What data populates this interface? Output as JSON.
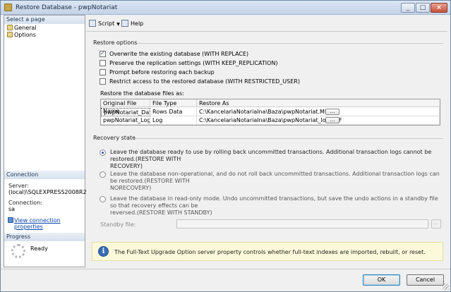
{
  "window": {
    "title": "Restore Database - pwpNotariat"
  },
  "sidebar": {
    "select_page_header": "Select a page",
    "pages": [
      {
        "label": "General",
        "icon": "page-icon"
      },
      {
        "label": "Options",
        "icon": "page-icon"
      }
    ],
    "connection": {
      "header": "Connection",
      "server_label": "Server:",
      "server_value": "(local)\\SQLEXPRESS2008R2",
      "connection_label": "Connection:",
      "connection_value": "sa",
      "view_properties_link": "View connection properties"
    },
    "progress": {
      "header": "Progress",
      "status": "Ready"
    }
  },
  "toolbar": {
    "script_label": "Script",
    "help_label": "Help"
  },
  "restore_options": {
    "title": "Restore options",
    "checkboxes": [
      {
        "label": "Overwrite the existing database (WITH REPLACE)",
        "checked": true
      },
      {
        "label": "Preserve the replication settings (WITH KEEP_REPLICATION)",
        "checked": false
      },
      {
        "label": "Prompt before restoring each backup",
        "checked": false
      },
      {
        "label": "Restrict access to the restored database (WITH RESTRICTED_USER)",
        "checked": false
      }
    ],
    "files_label": "Restore the database files as:",
    "grid": {
      "headers": [
        "Original File Name",
        "File Type",
        "Restore As"
      ],
      "rows": [
        {
          "original": "pwpNotariat_Data",
          "type": "Rows Data",
          "restore_as": "C:\\KancelariaNotarialna\\Baza\\pwpNotariat.MDF",
          "button": "..."
        },
        {
          "original": "pwpNotariat_Log",
          "type": "Log",
          "restore_as": "C:\\KancelariaNotarialna\\Baza\\pwpNotariat_log.LDF",
          "button": "..."
        }
      ]
    }
  },
  "recovery_state": {
    "title": "Recovery state",
    "options": [
      {
        "line1": "Leave the database ready to use by rolling back uncommitted transactions. Additional transaction logs cannot be restored.(RESTORE WITH",
        "line2": "RECOVERY)",
        "selected": true
      },
      {
        "line1": "Leave the database non-operational, and do not roll back uncommitted transactions. Additional transaction logs can be restored.(RESTORE WITH",
        "line2": "NORECOVERY)",
        "selected": false
      },
      {
        "line1": "Leave the database in read-only mode. Undo uncommitted transactions, but save the undo actions in a standby file so that recovery effects can be",
        "line2": "reversed.(RESTORE WITH STANDBY)",
        "selected": false
      }
    ],
    "standby_label": "Standby file:",
    "standby_value": "",
    "standby_button": "..."
  },
  "info": {
    "text": "The Full-Text Upgrade Option server property controls whether full-text indexes are imported, rebuilt, or reset."
  },
  "buttons": {
    "ok": "OK",
    "cancel": "Cancel"
  }
}
